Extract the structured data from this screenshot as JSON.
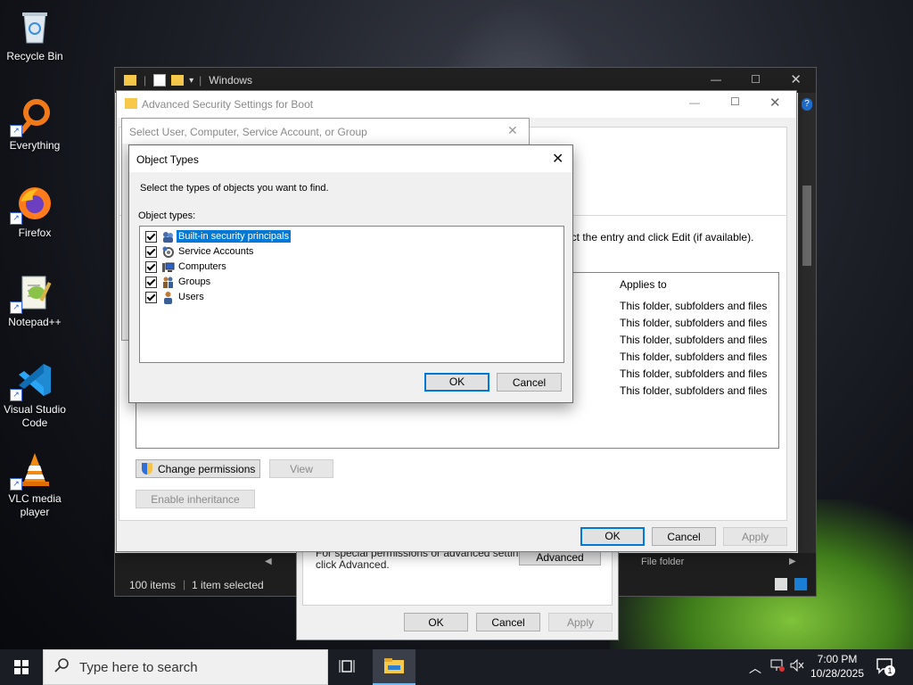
{
  "desktop": {
    "icons": [
      {
        "label": "Recycle Bin"
      },
      {
        "label": "Everything"
      },
      {
        "label": "Firefox"
      },
      {
        "label": "Notepad++"
      },
      {
        "label": "Visual Studio Code"
      },
      {
        "label": "VLC media player"
      }
    ]
  },
  "explorer": {
    "title": "Windows",
    "status": {
      "items": "100 items",
      "selected": "1 item selected"
    },
    "file_folder_text": "File folder"
  },
  "advanced": {
    "title": "Advanced Security Settings for Boot",
    "instruction_fragment": "ect the entry and click Edit (if available).",
    "column_applies_to": "Applies to",
    "applies_rows": [
      "This folder, subfolders and files",
      "This folder, subfolders and files",
      "This folder, subfolders and files",
      "This folder, subfolders and files",
      "This folder, subfolders and files",
      "This folder, subfolders and files"
    ],
    "change_permissions": "Change permissions",
    "view": "View",
    "enable_inheritance": "Enable inheritance",
    "ok": "OK",
    "cancel": "Cancel",
    "apply": "Apply"
  },
  "properties": {
    "special_text_1": "For special permissions or advanced settings,",
    "special_text_2": "click Advanced.",
    "advanced_button": "Advanced",
    "ok": "OK",
    "cancel": "Cancel",
    "apply": "Apply"
  },
  "select_user": {
    "title": "Select User, Computer, Service Account, or Group"
  },
  "object_types": {
    "title": "Object Types",
    "instruction": "Select the types of objects you want to find.",
    "list_label": "Object types:",
    "items": [
      {
        "label": "Built-in security principals",
        "checked": true,
        "selected": true,
        "icon": "builtin-principals-icon"
      },
      {
        "label": "Service Accounts",
        "checked": true,
        "selected": false,
        "icon": "service-accounts-icon"
      },
      {
        "label": "Computers",
        "checked": true,
        "selected": false,
        "icon": "computers-icon"
      },
      {
        "label": "Groups",
        "checked": true,
        "selected": false,
        "icon": "groups-icon"
      },
      {
        "label": "Users",
        "checked": true,
        "selected": false,
        "icon": "users-icon"
      }
    ],
    "ok": "OK",
    "cancel": "Cancel"
  },
  "taskbar": {
    "search_placeholder": "Type here to search",
    "time": "7:00 PM",
    "date": "10/28/2025",
    "notification_count": "1"
  }
}
